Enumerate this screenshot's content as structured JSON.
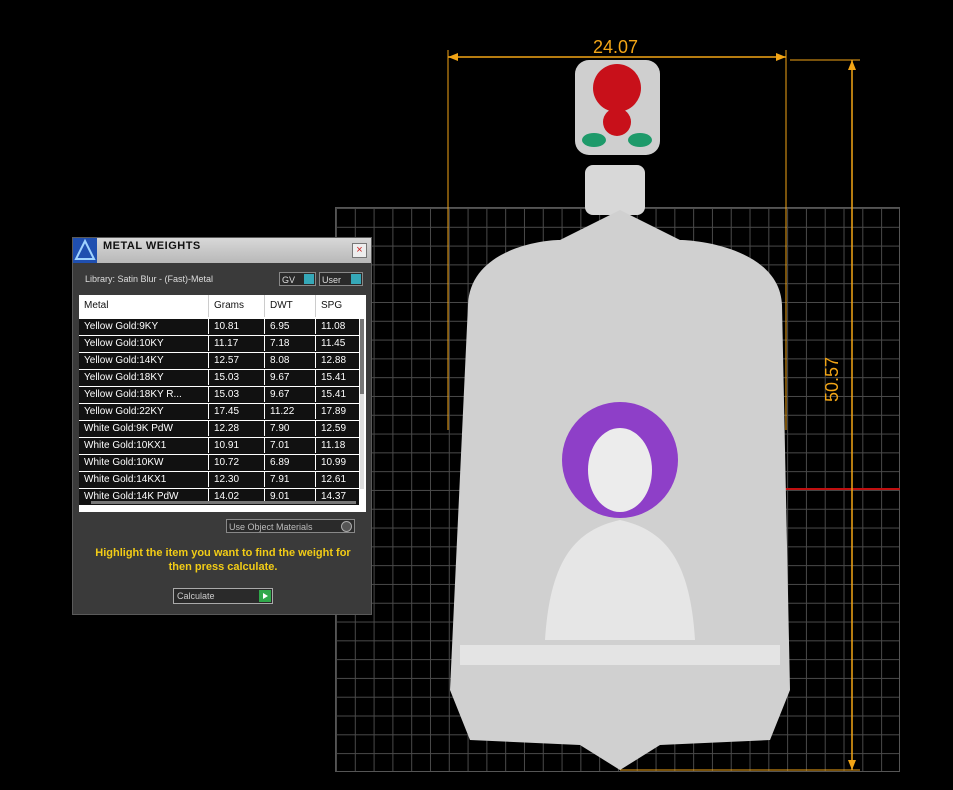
{
  "viewport": {
    "dimensions": {
      "width": "24.07",
      "height": "50.57"
    }
  },
  "dialog": {
    "title": "METAL WEIGHTS",
    "close_label": "×",
    "library": "Library: Satin Blur - (Fast)-Metal",
    "gv_label": "GV",
    "user_label": "User",
    "columns": [
      "Metal",
      "Grams",
      "DWT",
      "SPG"
    ],
    "rows": [
      [
        "Yellow Gold:9KY",
        "10.81",
        "6.95",
        "11.08"
      ],
      [
        "Yellow Gold:10KY",
        "11.17",
        "7.18",
        "11.45"
      ],
      [
        "Yellow Gold:14KY",
        "12.57",
        "8.08",
        "12.88"
      ],
      [
        "Yellow Gold:18KY",
        "15.03",
        "9.67",
        "15.41"
      ],
      [
        "Yellow Gold:18KY R...",
        "15.03",
        "9.67",
        "15.41"
      ],
      [
        "Yellow Gold:22KY",
        "17.45",
        "11.22",
        "17.89"
      ],
      [
        "White Gold:9K PdW",
        "12.28",
        "7.90",
        "12.59"
      ],
      [
        "White Gold:10KX1",
        "10.91",
        "7.01",
        "11.18"
      ],
      [
        "White Gold:10KW",
        "10.72",
        "6.89",
        "10.99"
      ],
      [
        "White Gold:14KX1",
        "12.30",
        "7.91",
        "12.61"
      ],
      [
        "White Gold:14K PdW",
        "14.02",
        "9.01",
        "14.37"
      ]
    ],
    "use_object_materials": "Use Object Materials",
    "hint": "Highlight the item you want to find the weight for then press calculate.",
    "calculate_label": "Calculate",
    "accent_color": "#f2cc16",
    "toggle_color": "#35a8b8",
    "go_color": "#2fa84a"
  }
}
